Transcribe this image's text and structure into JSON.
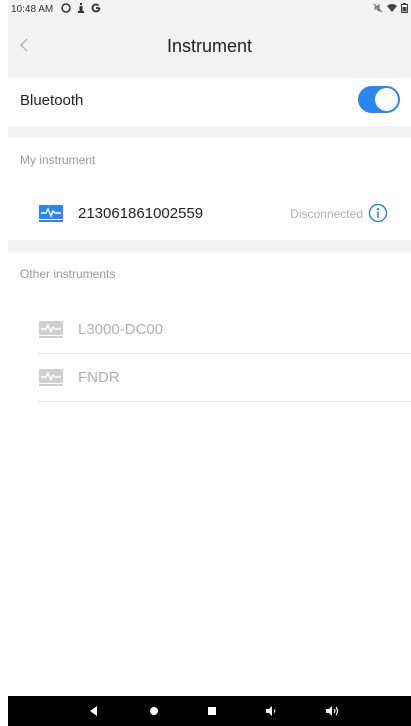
{
  "status_bar": {
    "time": "10:48 AM",
    "left_icons": [
      "compass-icon",
      "person-icon",
      "google-icon"
    ],
    "right_icons": [
      "mute-icon",
      "wifi-icon",
      "battery-icon"
    ]
  },
  "header": {
    "title": "Instrument",
    "back_icon": "chevron-left-icon"
  },
  "bluetooth": {
    "label": "Bluetooth",
    "enabled": true
  },
  "my_instrument": {
    "section_title": "My instrument",
    "device": {
      "name": "213061861002559",
      "status": "Disconnected"
    }
  },
  "other_instruments": {
    "section_title": "Other instruments",
    "devices": [
      {
        "name": "L3000-DC00"
      },
      {
        "name": "FNDR"
      }
    ]
  },
  "nav_bar": {
    "buttons": [
      "back-triangle-icon",
      "home-circle-icon",
      "recents-square-icon",
      "volume-down-icon",
      "volume-up-icon"
    ]
  },
  "colors": {
    "accent": "#2a86f0",
    "disabled_text": "#b0b0b0",
    "background_gray": "#f2f2f2"
  }
}
